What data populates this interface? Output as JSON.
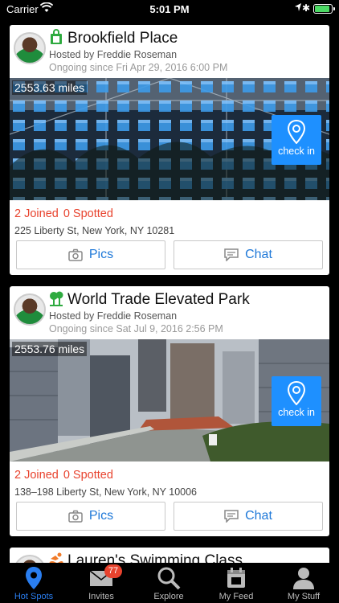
{
  "status_bar": {
    "carrier": "Carrier",
    "time": "5:01 PM"
  },
  "cards": [
    {
      "title": "Brookfield Place",
      "category_icon": "shopping-bag-icon",
      "host": "Hosted by Freddie Roseman",
      "since": "Ongoing since Fri Apr 29, 2016 6:00 PM",
      "distance": "2553.63 miles",
      "checkin_label": "check in",
      "joined": "2 Joined",
      "spotted": "0 Spotted",
      "address": "225 Liberty St, New York, NY 10281",
      "pics_label": "Pics",
      "chat_label": "Chat"
    },
    {
      "title": "World Trade Elevated Park",
      "category_icon": "park-tree-icon",
      "host": "Hosted by Freddie Roseman",
      "since": "Ongoing since Sat Jul 9, 2016 2:56 PM",
      "distance": "2553.76 miles",
      "checkin_label": "check in",
      "joined": "2 Joined",
      "spotted": "0 Spotted",
      "address": "138–198 Liberty St, New York, NY 10006",
      "pics_label": "Pics",
      "chat_label": "Chat"
    },
    {
      "title": "Lauren's Swimming Class",
      "category_icon": "swimmer-icon"
    }
  ],
  "tabs": [
    {
      "label": "Hot Spots",
      "icon": "location-pin-icon",
      "active": true
    },
    {
      "label": "Invites",
      "icon": "envelope-icon",
      "badge": "77"
    },
    {
      "label": "Explore",
      "icon": "magnifier-icon"
    },
    {
      "label": "My Feed",
      "icon": "calendar-icon"
    },
    {
      "label": "My Stuff",
      "icon": "person-icon"
    }
  ],
  "colors": {
    "accent_blue": "#1e90ff",
    "stat_red": "#e8432e",
    "tab_active": "#2a7ef0"
  }
}
